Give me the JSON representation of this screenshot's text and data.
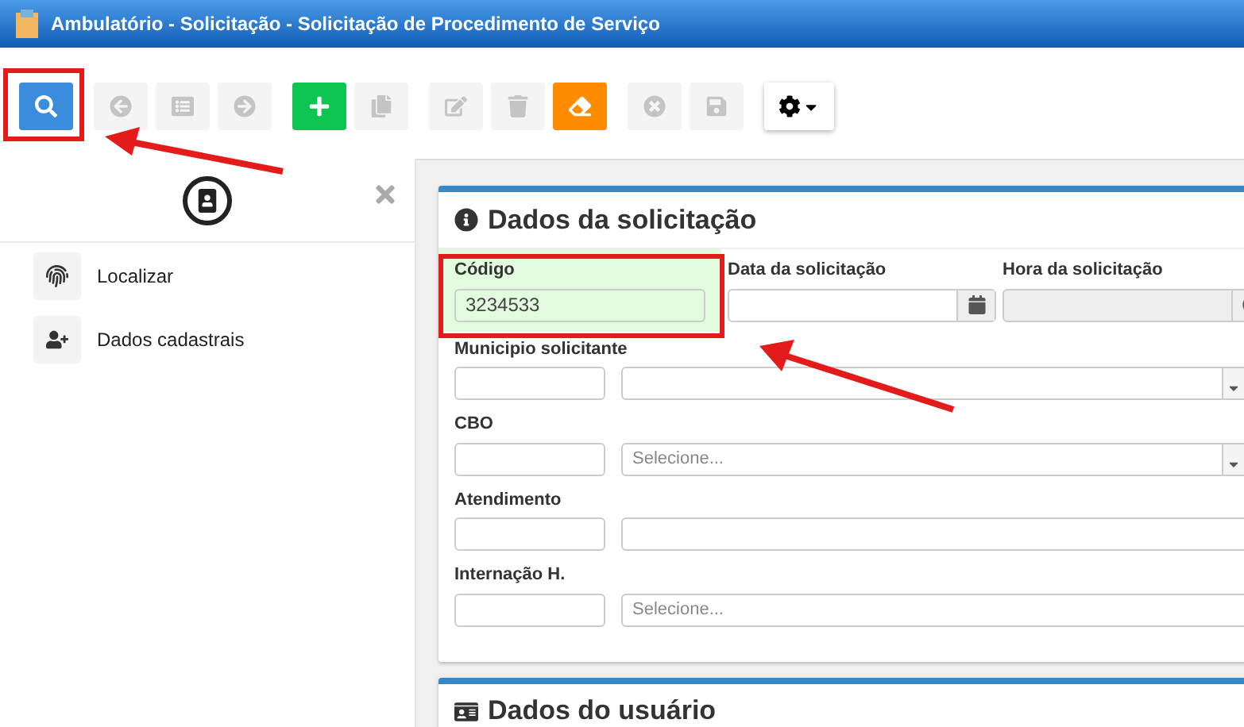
{
  "window": {
    "title": "Ambulatório - Solicitação - Solicitação de Procedimento de Serviço"
  },
  "toolbar": [
    {
      "kind": "primary"
    },
    {
      "kind": "spacer"
    },
    {
      "kind": "muted"
    },
    {
      "kind": "muted"
    },
    {
      "kind": "muted"
    },
    {
      "kind": "spacer"
    },
    {
      "kind": "success"
    },
    {
      "kind": "muted"
    },
    {
      "kind": "spacer"
    },
    {
      "kind": "muted"
    },
    {
      "kind": "muted"
    },
    {
      "kind": "warning"
    },
    {
      "kind": "spacer"
    },
    {
      "kind": "muted"
    },
    {
      "kind": "muted"
    },
    {
      "kind": "spacer"
    },
    {
      "kind": "dropdown"
    }
  ],
  "sidebar": {
    "items": [
      {
        "label": "Localizar"
      },
      {
        "label": "Dados cadastrais"
      }
    ]
  },
  "sections": [
    {
      "title": "Dados da solicitação",
      "top_fields": [
        {
          "label": "Código",
          "value": "3234533",
          "highlighted": true,
          "disabled": false
        },
        {
          "label": "Data da solicitação",
          "highlighted": false,
          "disabled": false
        },
        {
          "label": "Hora da solicitação",
          "highlighted": false,
          "disabled": true
        }
      ],
      "lookup_rows": [
        {
          "label": "Municipio solicitante",
          "dropdown": true
        },
        {
          "label": "CBO",
          "placeholder": "Selecione...",
          "dropdown": true
        },
        {
          "label": "Atendimento",
          "dropdown": false
        },
        {
          "label": "Internação H.",
          "placeholder": "Selecione...",
          "dropdown": false
        }
      ]
    },
    {
      "title": "Dados do usuário"
    }
  ]
}
